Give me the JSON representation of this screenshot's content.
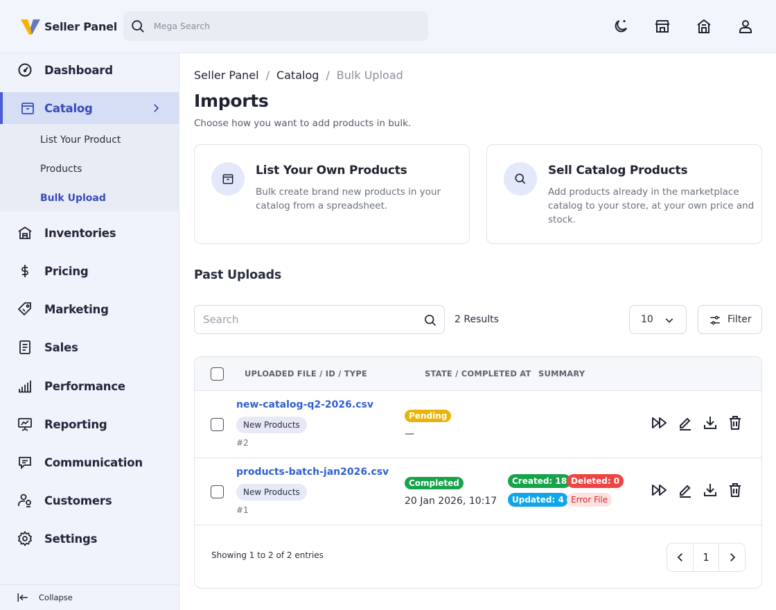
{
  "header": {
    "brand": "Seller Panel",
    "search_placeholder": "Mega Search",
    "icons": [
      "moon-icon",
      "store-icon",
      "shop-icon",
      "user-icon"
    ]
  },
  "sidebar": {
    "items": [
      {
        "label": "Dashboard",
        "icon": "gauge-icon"
      },
      {
        "label": "Catalog",
        "icon": "box-icon",
        "active": true,
        "children": [
          {
            "label": "List Your Product"
          },
          {
            "label": "Products"
          },
          {
            "label": "Bulk Upload",
            "active": true
          }
        ]
      },
      {
        "label": "Inventories",
        "icon": "warehouse-icon"
      },
      {
        "label": "Pricing",
        "icon": "dollar-icon"
      },
      {
        "label": "Marketing",
        "icon": "tag-icon"
      },
      {
        "label": "Sales",
        "icon": "receipt-icon"
      },
      {
        "label": "Performance",
        "icon": "signal-icon"
      },
      {
        "label": "Reporting",
        "icon": "presentation-icon"
      },
      {
        "label": "Communication",
        "icon": "message-icon"
      },
      {
        "label": "Customers",
        "icon": "customers-icon"
      },
      {
        "label": "Settings",
        "icon": "gear-icon"
      }
    ],
    "collapse_label": "Collapse"
  },
  "breadcrumb": {
    "items": [
      "Seller Panel",
      "Catalog",
      "Bulk Upload"
    ],
    "separator": "/"
  },
  "page": {
    "title": "Imports",
    "subtitle": "Choose how you want to add products in bulk."
  },
  "cards": [
    {
      "title": "List Your Own Products",
      "description": "Bulk create brand new products in your catalog from a spreadsheet.",
      "icon": "box-icon"
    },
    {
      "title": "Sell Catalog Products",
      "description": "Add products already in the marketplace catalog to your store, at your own price and stock.",
      "icon": "search-icon"
    }
  ],
  "past_uploads": {
    "title": "Past Uploads",
    "search_placeholder": "Search",
    "results": "2 Results",
    "per_page": "10",
    "filter_label": "Filter",
    "columns": [
      "UPLOADED FILE / ID / TYPE",
      "STATE / COMPLETED AT",
      "SUMMARY"
    ],
    "rows": [
      {
        "file": "new-catalog-q2-2026.csv",
        "type": "New Products",
        "id": "#2",
        "state": "Pending",
        "completed_at": "—",
        "summary": null
      },
      {
        "file": "products-batch-jan2026.csv",
        "type": "New Products",
        "id": "#1",
        "state": "Completed",
        "completed_at": "20 Jan 2026, 10:17",
        "summary": {
          "created": "Created: 18",
          "deleted": "Deleted: 0",
          "updated": "Updated: 4",
          "error": "Error File"
        }
      }
    ],
    "footer": "Showing 1 to 2 of 2 entries",
    "page": "1"
  },
  "colors": {
    "accent": "#4a5bd6",
    "link": "#2f5fd1",
    "pending": "#eab308",
    "completed": "#16a34a",
    "deleted": "#ef4444",
    "updated": "#0ea5e9",
    "logo_yellow": "#f4b400",
    "logo_blue": "#4f6be8"
  }
}
